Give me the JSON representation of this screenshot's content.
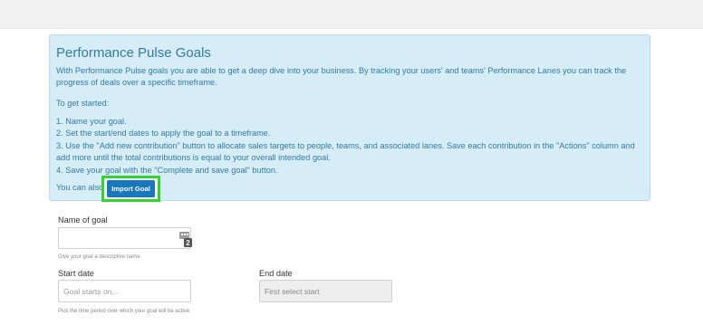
{
  "info": {
    "title": "Performance Pulse Goals",
    "intro": "With Performance Pulse goals you are able to get a deep dive into your business. By tracking your users' and teams' Performance Lanes you can track the progress of deals over a specific timeframe.",
    "get_started": "To get started:",
    "steps": [
      "1. Name your goal.",
      "2. Set the start/end dates to apply the goal to a timeframe.",
      "3. Use the \"Add new contribution\" button to allocate sales targets to people, teams, and associated lanes. Save each contribution in the \"Actions\" column and add more until the total contributions is equal to your overall intended goal.",
      "4. Save your goal with the \"Complete and save goal\" button."
    ],
    "also_prefix": "You can also",
    "import_label": "Import Goal"
  },
  "form": {
    "name_label": "Name of goal",
    "name_value": "",
    "name_hint": "Give your goal a descriptive name",
    "counter_icon": "character-counter-icon",
    "counter_badge": "2",
    "start_label": "Start date",
    "start_placeholder": "Goal starts on...",
    "end_label": "End date",
    "end_placeholder": "First select start",
    "period_hint": "Pick the time period over which your goal will be active"
  },
  "colors": {
    "panel_bg": "#d6ecf6",
    "panel_text": "#2f7ca6",
    "button": "#1877be",
    "highlight": "#2fd52b"
  }
}
